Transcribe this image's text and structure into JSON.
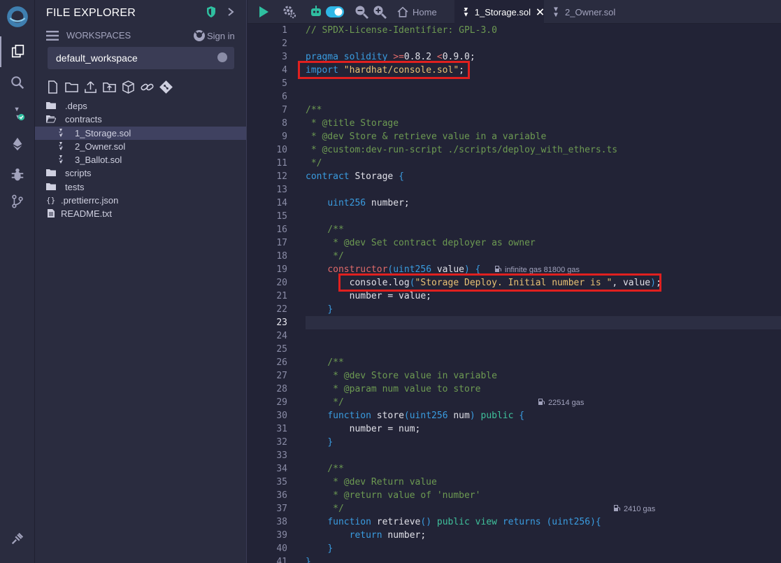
{
  "panel": {
    "title": "FILE EXPLORER",
    "workspaces_label": "WORKSPACES",
    "signin_label": "Sign in",
    "workspace_selected": "default_workspace"
  },
  "tree": [
    {
      "label": ".deps",
      "kind": "folder",
      "depth": 0
    },
    {
      "label": "contracts",
      "kind": "folder-open",
      "depth": 0
    },
    {
      "label": "1_Storage.sol",
      "kind": "sol",
      "depth": 1,
      "selected": true
    },
    {
      "label": "2_Owner.sol",
      "kind": "sol",
      "depth": 1
    },
    {
      "label": "3_Ballot.sol",
      "kind": "sol",
      "depth": 1
    },
    {
      "label": "scripts",
      "kind": "folder",
      "depth": 0
    },
    {
      "label": "tests",
      "kind": "folder",
      "depth": 0
    },
    {
      "label": ".prettierrc.json",
      "kind": "json",
      "depth": 0
    },
    {
      "label": "README.txt",
      "kind": "txt",
      "depth": 0
    }
  ],
  "tabs": {
    "home": "Home",
    "active": "1_Storage.sol",
    "other": "2_Owner.sol"
  },
  "editor": {
    "current_line": 23,
    "lines": [
      "// SPDX-License-Identifier: GPL-3.0",
      "",
      "pragma solidity >=0.8.2 <0.9.0;",
      "import \"hardhat/console.sol\";",
      "",
      "",
      "/**",
      " * @title Storage",
      " * @dev Store & retrieve value in a variable",
      " * @custom:dev-run-script ./scripts/deploy_with_ethers.ts",
      " */",
      "contract Storage {",
      "",
      "    uint256 number;",
      "",
      "    /**",
      "     * @dev Set contract deployer as owner",
      "     */",
      "    constructor(uint256 value) {",
      "        console.log(\"Storage Deploy. Initial number is \", value);",
      "        number = value;",
      "    }",
      "",
      "",
      "",
      "    /**",
      "     * @dev Store value in variable",
      "     * @param num value to store",
      "     */",
      "    function store(uint256 num) public {",
      "        number = num;",
      "    }",
      "",
      "    /**",
      "     * @dev Return value",
      "     * @return value of 'number'",
      "     */",
      "    function retrieve() public view returns (uint256){",
      "        return number;",
      "    }",
      "}"
    ],
    "gas_hints": [
      {
        "line": 19,
        "text": "infinite gas 81800 gas"
      },
      {
        "line": 29,
        "text": "22514 gas"
      },
      {
        "line": 37,
        "text": "2410 gas"
      }
    ]
  },
  "colors": {
    "accent": "#2fbfa0",
    "highlight_box": "#e0201f",
    "keyword": "#3a9ce0",
    "comment": "#6d9a52",
    "string": "#e8c174"
  }
}
